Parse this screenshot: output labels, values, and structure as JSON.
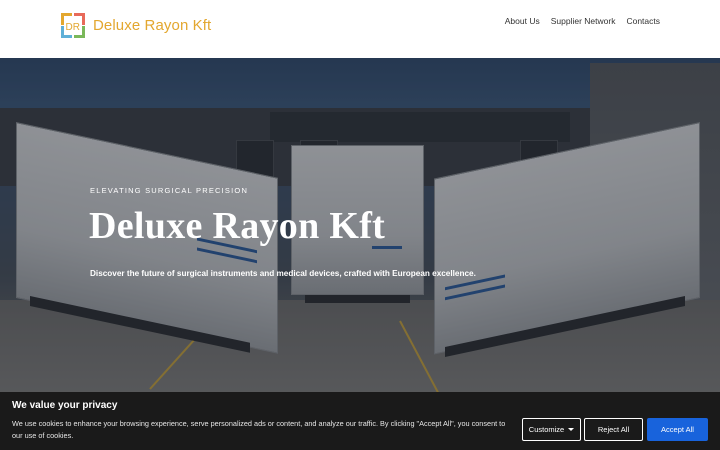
{
  "header": {
    "logo_text": "Deluxe Rayon Kft",
    "logo_letters": "DR",
    "nav": [
      "About Us",
      "Supplier Network",
      "Contacts"
    ]
  },
  "hero": {
    "kicker": "ELEVATING SURGICAL PRECISION",
    "title": "Deluxe Rayon Kft",
    "description": "Discover the future of surgical instruments and medical devices, crafted with European excellence."
  },
  "cookie_banner": {
    "title": "We value your privacy",
    "text": "We use cookies to enhance your browsing experience, serve personalized ads or content, and analyze our traffic. By clicking \"Accept All\", you consent to our use of cookies.",
    "customize_label": "Customize",
    "reject_label": "Reject All",
    "accept_label": "Accept All"
  },
  "colors": {
    "brand": "#e3a72f",
    "accept_button": "#1863dc",
    "banner_bg": "#1a1a1a"
  }
}
